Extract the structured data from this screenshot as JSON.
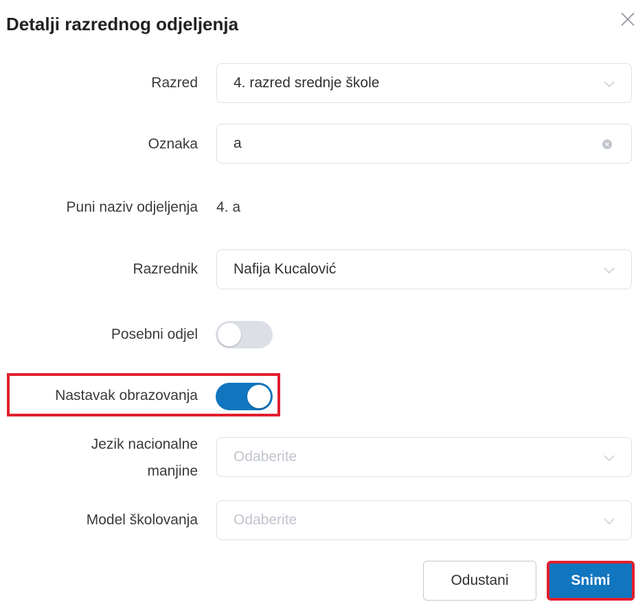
{
  "dialog": {
    "title": "Detalji razrednog odjeljenja"
  },
  "form": {
    "razred": {
      "label": "Razred",
      "value": "4. razred srednje škole"
    },
    "oznaka": {
      "label": "Oznaka",
      "value": "a"
    },
    "puni_naziv": {
      "label": "Puni naziv odjeljenja",
      "value": "4. a"
    },
    "razrednik": {
      "label": "Razrednik",
      "value": "Nafija Kucalović"
    },
    "posebni_odjel": {
      "label": "Posebni odjel",
      "checked": false
    },
    "nastavak_obrazovanja": {
      "label": "Nastavak obrazovanja",
      "checked": true
    },
    "jezik": {
      "label_line1": "Jezik nacionalne",
      "label_line2": "manjine",
      "placeholder": "Odaberite"
    },
    "model": {
      "label": "Model školovanja",
      "placeholder": "Odaberite"
    }
  },
  "buttons": {
    "cancel": "Odustani",
    "save": "Snimi"
  },
  "colors": {
    "accent": "#1176bf",
    "highlight": "#e21e2e",
    "switch_off": "#dcdfe6"
  },
  "icons": {
    "close": "close-icon",
    "dropdown": "chevron-down-icon",
    "clear": "clear-icon"
  }
}
